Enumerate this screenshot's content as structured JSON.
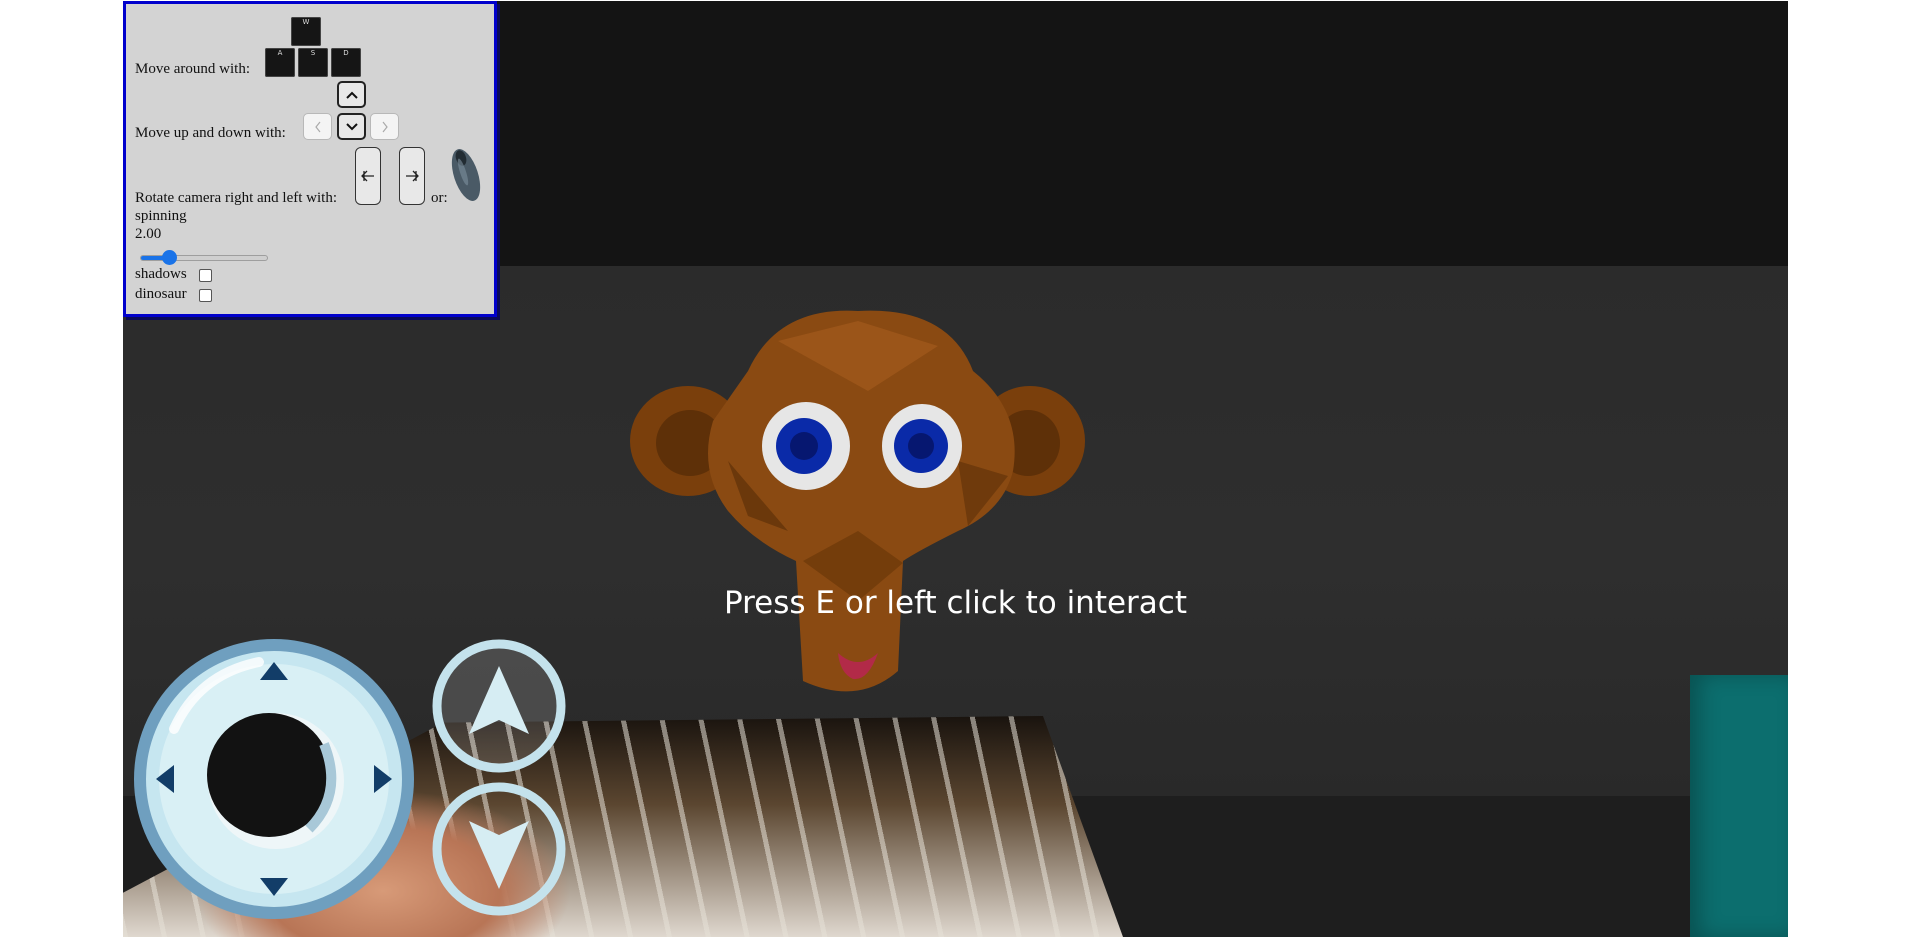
{
  "controls": {
    "move_label": "Move around with:",
    "move_keys": [
      "W",
      "A",
      "S",
      "D"
    ],
    "updown_label": "Move up and down with:",
    "rotate_label": "Rotate camera right and left with:",
    "or_label": "or:",
    "spinning_label": "spinning",
    "spinning_value": "2.00",
    "spinning_fraction": 0.22,
    "shadows_label": "shadows",
    "shadows_checked": false,
    "dinosaur_label": "dinosaur",
    "dinosaur_checked": false
  },
  "hint": "Press E or left click to interact",
  "colors": {
    "panel_border": "#0000cc",
    "panel_bg": "#d3d3d3",
    "slider_accent": "#1a73e8",
    "monkey": "#8a4a12",
    "eyes": "#0a2aa8",
    "teal_block": "#0c6e6e",
    "joystick_ring": "#bfe3ee"
  },
  "icons": {
    "up_arrow": "chevron-up-icon",
    "down_arrow": "chevron-down-icon",
    "left_arrow": "chevron-left-icon",
    "right_arrow": "chevron-right-icon",
    "rotate_left": "arrow-left-icon",
    "rotate_right": "arrow-right-icon",
    "mouse": "mouse-icon"
  }
}
